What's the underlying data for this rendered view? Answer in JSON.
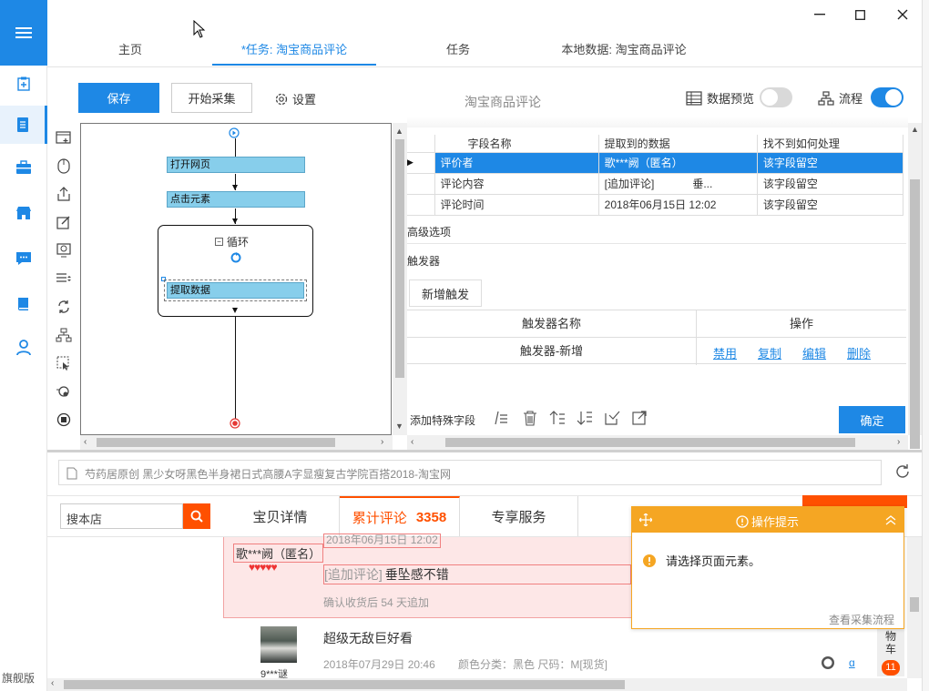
{
  "top_tabs": [
    "主页",
    "*任务: 淘宝商品评论",
    "任务",
    "本地数据: 淘宝商品评论"
  ],
  "toolbar": {
    "save": "保存",
    "start": "开始采集",
    "settings": "设置",
    "task_title": "淘宝商品评论",
    "preview": "数据预览",
    "flow": "流程"
  },
  "left_bottom": "旗舰版",
  "flow_nodes": {
    "open": "打开网页",
    "click": "点击元素",
    "loop": "循环",
    "extract": "提取数据"
  },
  "fields": {
    "headers": [
      "字段名称",
      "提取到的数据",
      "找不到如何处理"
    ],
    "rows": [
      {
        "name": "评价者",
        "value": "歌***阙（匿名）",
        "handle": "该字段留空"
      },
      {
        "name": "评论内容",
        "value": "[追加评论]",
        "extra": "垂...",
        "handle": "该字段留空"
      },
      {
        "name": "评论时间",
        "value": "2018年06月15日 12:02",
        "handle": "该字段留空"
      }
    ]
  },
  "advanced": "高级选项",
  "trigger": {
    "section": "触发器",
    "add": "新增触发",
    "col_name": "触发器名称",
    "col_op": "操作",
    "row_name": "触发器-新增",
    "ops": [
      "禁用",
      "复制",
      "编辑",
      "删除"
    ]
  },
  "bottom_bar": {
    "special": "添加特殊字段",
    "confirm": "确定"
  },
  "browser": {
    "address": "芍药居原创 黑少女呀黑色半身裙日式高腰A字显瘦复古学院百搭2018-淘宝网",
    "search_placeholder": "搜本店",
    "tabs": [
      "宝贝详情",
      "累计评论",
      "专享服务"
    ],
    "review_count": "3358",
    "review1": {
      "user": "歌***阙（匿名）",
      "time": "2018年06月15日 12:02",
      "content_tag": "[追加评论]",
      "content": "垂坠感不错",
      "note": "确认收货后 54 天追加"
    },
    "review2": {
      "user": "9***谜",
      "content": "超级无敌巨好看",
      "time": "2018年07月29日 20:46",
      "attrs": "颜色分类：黑色  尺码：M[现货]"
    },
    "cart": "物车",
    "cart_badge": "11"
  },
  "tip": {
    "title": "操作提示",
    "message": "请选择页面元素。",
    "link": "查看采集流程"
  },
  "colors": {
    "accent": "#1e88e5",
    "taobao_orange": "#ff5000",
    "tip_orange": "#f5a623"
  }
}
